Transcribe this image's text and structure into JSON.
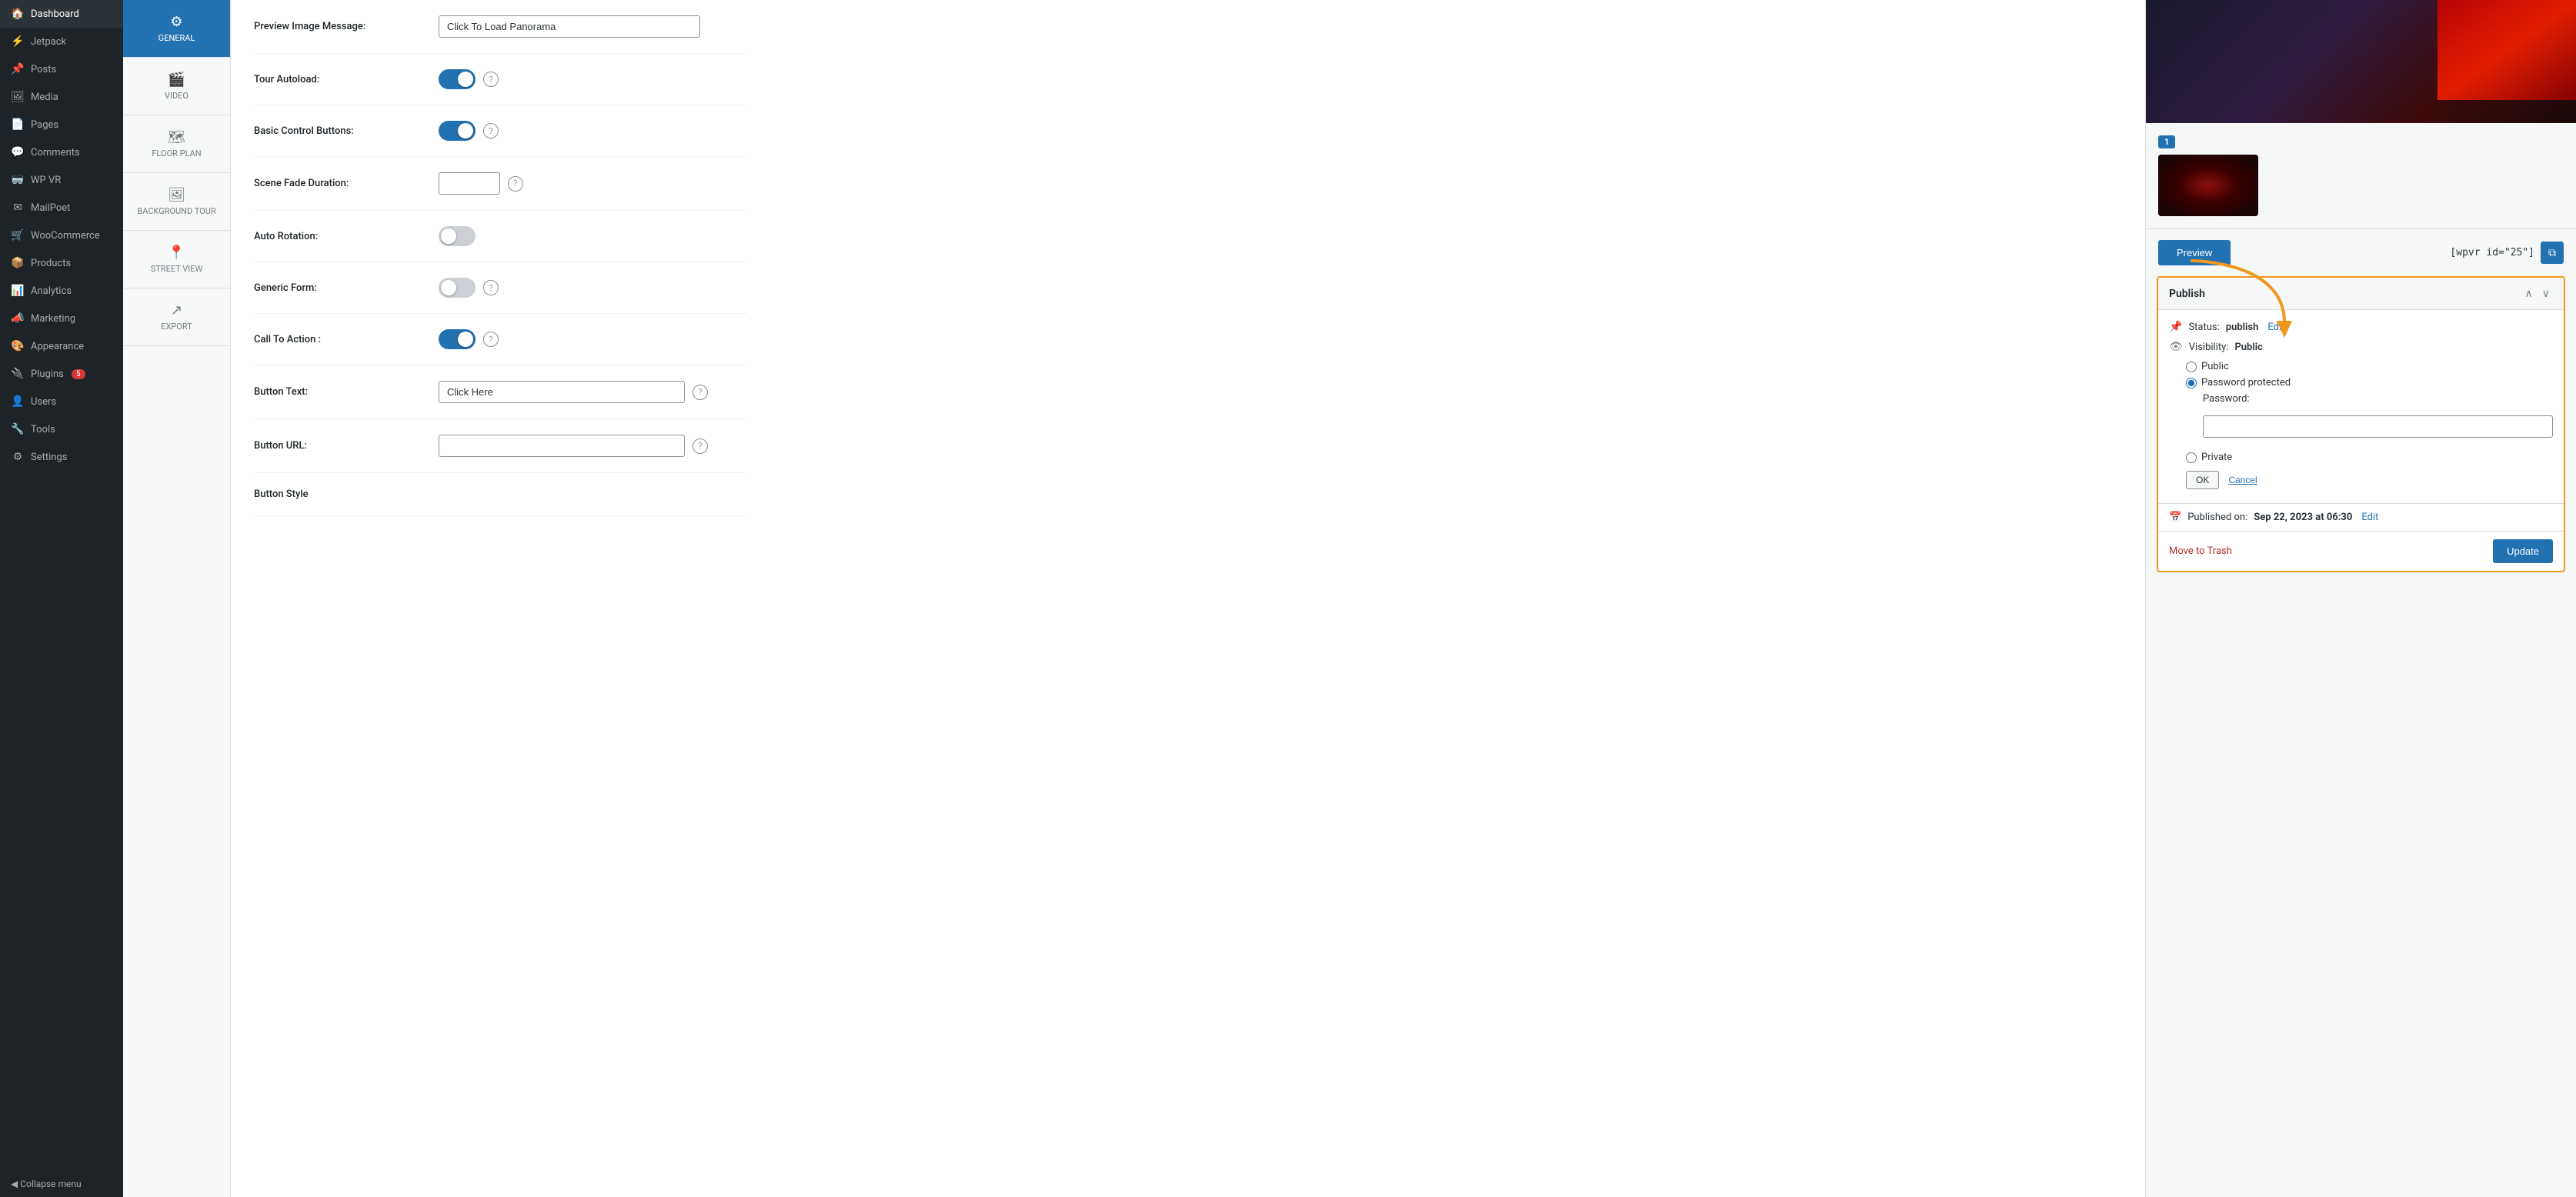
{
  "sidebar": {
    "items": [
      {
        "id": "dashboard",
        "label": "Dashboard",
        "icon": "🏠"
      },
      {
        "id": "jetpack",
        "label": "Jetpack",
        "icon": "⚡"
      },
      {
        "id": "posts",
        "label": "Posts",
        "icon": "📌"
      },
      {
        "id": "media",
        "label": "Media",
        "icon": "🖼"
      },
      {
        "id": "pages",
        "label": "Pages",
        "icon": "📄"
      },
      {
        "id": "comments",
        "label": "Comments",
        "icon": "💬"
      },
      {
        "id": "wpvr",
        "label": "WP VR",
        "icon": "🥽"
      },
      {
        "id": "mailpoet",
        "label": "MailPoet",
        "icon": "✉"
      },
      {
        "id": "woocommerce",
        "label": "WooCommerce",
        "icon": "🛒"
      },
      {
        "id": "products",
        "label": "Products",
        "icon": "📦"
      },
      {
        "id": "analytics",
        "label": "Analytics",
        "icon": "📊"
      },
      {
        "id": "marketing",
        "label": "Marketing",
        "icon": "📣"
      },
      {
        "id": "appearance",
        "label": "Appearance",
        "icon": "🎨"
      },
      {
        "id": "plugins",
        "label": "Plugins",
        "icon": "🔌",
        "badge": "5"
      },
      {
        "id": "users",
        "label": "Users",
        "icon": "👤"
      },
      {
        "id": "tools",
        "label": "Tools",
        "icon": "🔧"
      },
      {
        "id": "settings",
        "label": "Settings",
        "icon": "⚙"
      }
    ],
    "collapse_label": "Collapse menu"
  },
  "sub_sidebar": {
    "items": [
      {
        "id": "general",
        "label": "GENERAL",
        "icon": "⚙",
        "active": true
      },
      {
        "id": "video",
        "label": "VIDEO",
        "icon": "🎬"
      },
      {
        "id": "floor_plan",
        "label": "FLOOR PLAN",
        "icon": "🗺"
      },
      {
        "id": "background_tour",
        "label": "BACKGROUND TOUR",
        "icon": "🖼"
      },
      {
        "id": "street_view",
        "label": "STREET VIEW",
        "icon": "📍"
      },
      {
        "id": "export",
        "label": "EXPORT",
        "icon": "↗"
      }
    ]
  },
  "form": {
    "fields": [
      {
        "id": "preview_image_message",
        "label": "Preview Image Message:",
        "type": "text",
        "value": "Click To Load Panorama"
      },
      {
        "id": "tour_autoload",
        "label": "Tour Autoload:",
        "type": "toggle",
        "checked": true
      },
      {
        "id": "basic_control_buttons",
        "label": "Basic Control Buttons:",
        "type": "toggle",
        "checked": true
      },
      {
        "id": "scene_fade_duration",
        "label": "Scene Fade Duration:",
        "type": "text_small",
        "value": ""
      },
      {
        "id": "auto_rotation",
        "label": "Auto Rotation:",
        "type": "toggle",
        "checked": false
      },
      {
        "id": "generic_form",
        "label": "Generic Form:",
        "type": "toggle",
        "checked": false
      },
      {
        "id": "call_to_action",
        "label": "Call To Action :",
        "type": "toggle",
        "checked": true
      },
      {
        "id": "button_text",
        "label": "Button Text:",
        "type": "text",
        "value": "Click Here"
      },
      {
        "id": "button_url",
        "label": "Button URL:",
        "type": "text",
        "value": ""
      },
      {
        "id": "button_style",
        "label": "Button Style",
        "type": "section"
      }
    ]
  },
  "right_panel": {
    "tour_number": "1",
    "preview_button": "Preview",
    "shortcode": "[wpvr id=\"25\"]",
    "copy_tooltip": "Copy",
    "publish": {
      "title": "Publish",
      "status_label": "Status:",
      "status_value": "publish",
      "edit_link": "Edit",
      "visibility_label": "Visibility:",
      "visibility_value": "Public",
      "visibility_options": [
        {
          "id": "public",
          "label": "Public",
          "selected": false
        },
        {
          "id": "password_protected",
          "label": "Password protected",
          "selected": true
        },
        {
          "id": "private",
          "label": "Private",
          "selected": false
        }
      ],
      "password_label": "Password:",
      "password_value": "",
      "ok_label": "OK",
      "cancel_label": "Cancel",
      "published_on_label": "Published on:",
      "published_on_date": "Sep 22, 2023 at 06:30",
      "published_edit_link": "Edit",
      "move_to_trash": "Move to Trash",
      "update_button": "Update"
    }
  }
}
